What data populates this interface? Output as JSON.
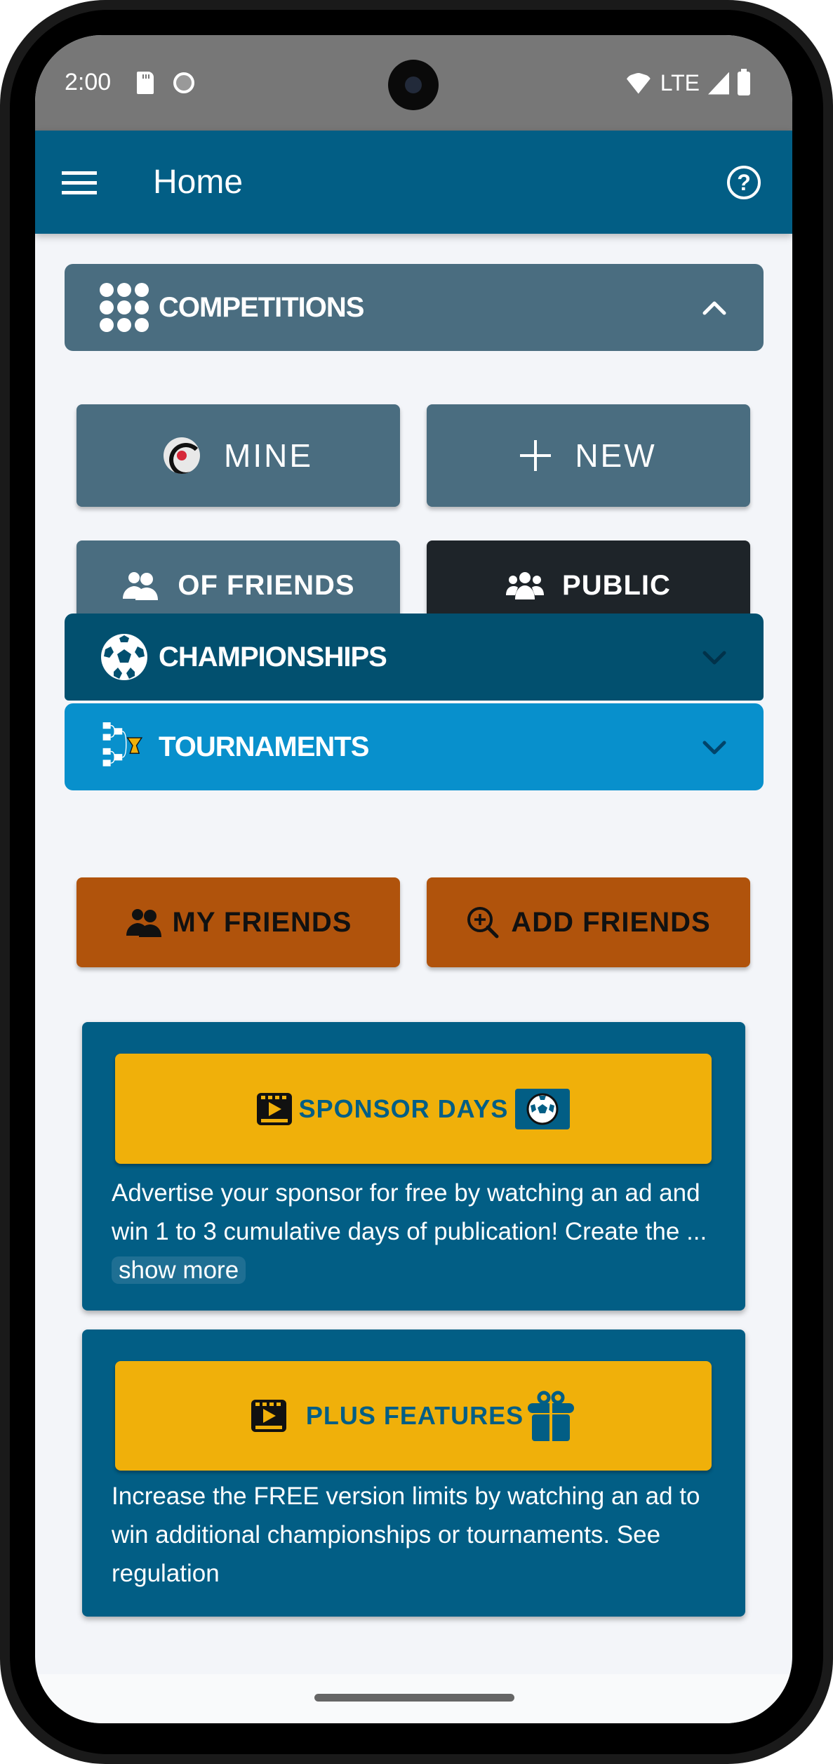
{
  "status_bar": {
    "time": "2:00",
    "left_icons": [
      "sd-card-icon",
      "cat-face-icon"
    ],
    "network": "LTE",
    "right_icons": [
      "wifi-icon",
      "signal-icon",
      "battery-icon"
    ]
  },
  "app_bar": {
    "title": "Home",
    "menu_icon": "hamburger-menu-icon",
    "help_icon": "help-circle-icon",
    "help_glyph": "?"
  },
  "competitions": {
    "header": "COMPETITIONS",
    "icon": "grid-dots-icon",
    "expanded": true,
    "buttons": [
      {
        "label": "MINE",
        "icon": "app-logo-icon"
      },
      {
        "label": "NEW",
        "icon": "plus-icon"
      },
      {
        "label": "OF FRIENDS",
        "icon": "two-people-icon"
      },
      {
        "label": "PUBLIC",
        "icon": "group-people-icon",
        "selected": true
      }
    ]
  },
  "championships": {
    "header": "CHAMPIONSHIPS",
    "icon": "soccer-ball-icon",
    "expanded": false
  },
  "tournaments": {
    "header": "TOURNAMENTS",
    "icon": "bracket-trophy-icon",
    "expanded": false
  },
  "friends": {
    "my_friends": "MY FRIENDS",
    "add_friends": "ADD FRIENDS"
  },
  "sponsor_card": {
    "button_label": "SPONSOR DAYS",
    "description": "Advertise your sponsor for free by watching an ad and win 1 to 3 cumulative days of publication! Create the ...",
    "show_more": "show more"
  },
  "plus_card": {
    "button_label": "PLUS FEATURES",
    "description": "Increase the FREE version limits by watching an ad to win additional championships or tournaments. See regulation"
  },
  "colors": {
    "app_bar": "#025e85",
    "section_gray": "#4a6d80",
    "championships": "#02506f",
    "tournaments": "#0890cc",
    "public_selected": "#1e2429",
    "friends_orange": "#b0530c",
    "ad_yellow": "#f0b00a",
    "background": "#f3f5f9"
  }
}
